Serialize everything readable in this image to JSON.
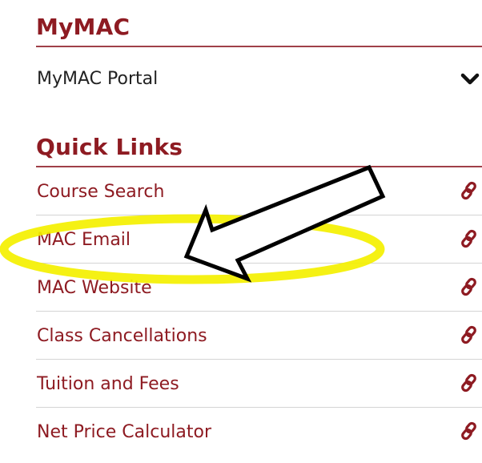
{
  "mymac": {
    "title": "MyMAC",
    "portal_label": "MyMAC Portal",
    "expand_icon": "chevron-down-icon"
  },
  "quick_links": {
    "title": "Quick Links",
    "items": [
      {
        "label": "Course Search",
        "icon": "link-icon"
      },
      {
        "label": "MAC Email",
        "icon": "link-icon"
      },
      {
        "label": "MAC Website",
        "icon": "link-icon"
      },
      {
        "label": "Class Cancellations",
        "icon": "link-icon"
      },
      {
        "label": "Tuition and Fees",
        "icon": "link-icon"
      },
      {
        "label": "Net Price Calculator",
        "icon": "link-icon"
      }
    ]
  },
  "annotation": {
    "highlight_color": "#f4f000",
    "arrow_fill": "#ffffff",
    "arrow_stroke": "#000000",
    "target_item": "MAC Email"
  },
  "colors": {
    "accent": "#8e1b22",
    "rule": "#a04048",
    "separator": "#d4d4d4"
  }
}
